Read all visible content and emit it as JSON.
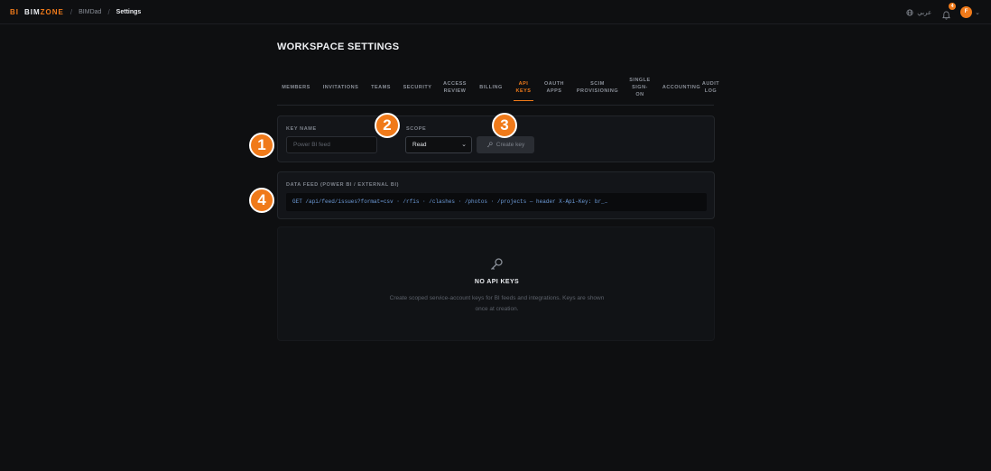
{
  "topbar": {
    "logo_bi": "BI",
    "logo_name_a": "BIM",
    "logo_name_b": "ZONE",
    "breadcrumbs": [
      "BIMDad",
      "Settings"
    ],
    "language": "عربي",
    "notification_count": "4",
    "avatar_initial": "F"
  },
  "page": {
    "title": "WORKSPACE SETTINGS"
  },
  "tabs": [
    {
      "label": "MEMBERS"
    },
    {
      "label": "INVITATIONS"
    },
    {
      "label": "TEAMS"
    },
    {
      "label": "SECURITY"
    },
    {
      "label": "ACCESS\nREVIEW"
    },
    {
      "label": "BILLING"
    },
    {
      "label": "API\nKEYS"
    },
    {
      "label": "OAUTH\nAPPS"
    },
    {
      "label": "SCIM\nPROVISIONING"
    },
    {
      "label": "SINGLE\nSIGN-\nON"
    },
    {
      "label": "ACCOUNTING"
    },
    {
      "label": "AUDIT\nLOG"
    }
  ],
  "active_tab": "API KEYS",
  "create_form": {
    "key_name_label": "KEY NAME",
    "key_name_placeholder": "Power BI feed",
    "scope_label": "SCOPE",
    "scope_value": "Read",
    "create_button": "Create key"
  },
  "data_feed": {
    "label": "DATA FEED (POWER BI / EXTERNAL BI)",
    "code": "GET /api/feed/issues?format=csv · /rfis · /clashes · /photos · /projects — header X-Api-Key: br_…"
  },
  "empty_state": {
    "title": "NO API KEYS",
    "description": "Create scoped service-account keys for BI feeds and integrations. Keys are shown once at creation."
  },
  "markers": [
    "1",
    "2",
    "3",
    "4"
  ],
  "colors": {
    "accent": "#f07a1a",
    "background": "#0e0f11",
    "card": "#131519",
    "code_text": "#6d9bd8"
  }
}
